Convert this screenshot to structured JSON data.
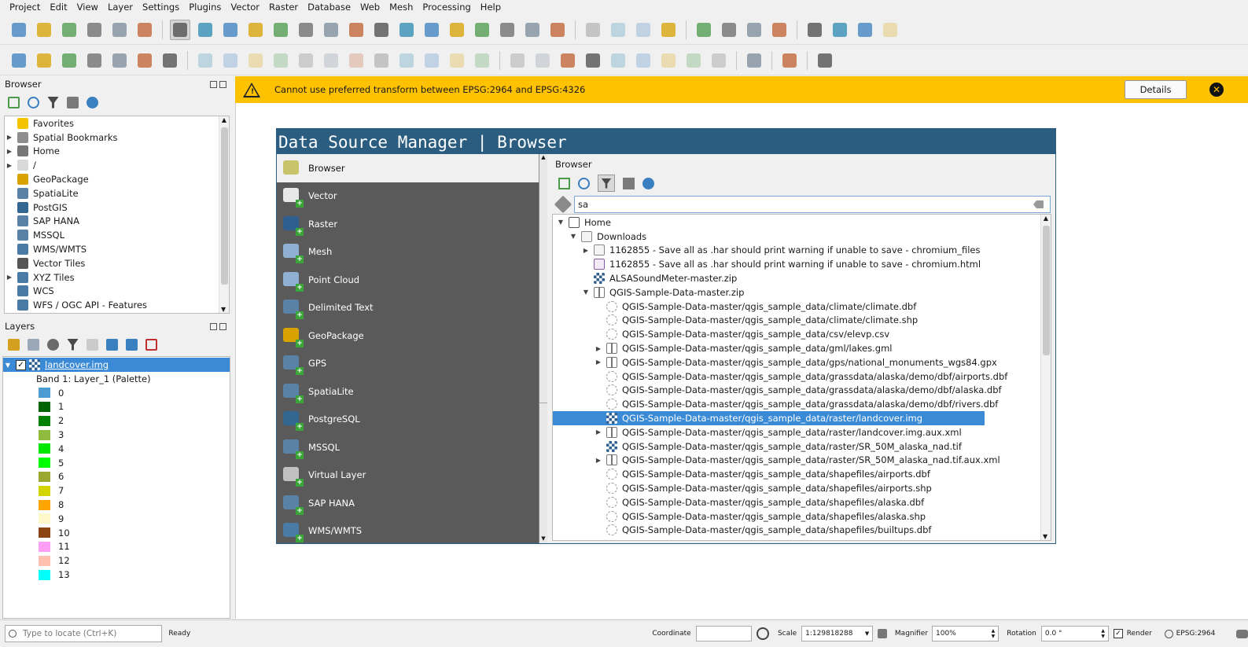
{
  "menus": [
    "Project",
    "Edit",
    "View",
    "Layer",
    "Settings",
    "Plugins",
    "Vector",
    "Raster",
    "Database",
    "Web",
    "Mesh",
    "Processing",
    "Help"
  ],
  "toolbar1_icons": [
    "new-project-icon",
    "open-project-icon",
    "save-project-icon",
    "new-print-layout-icon",
    "layout-manager-icon",
    "style-manager-icon",
    "pan-icon",
    "pan-to-selection-icon",
    "zoom-in-icon",
    "zoom-out-icon",
    "zoom-full-icon",
    "zoom-to-selection-icon",
    "zoom-to-layer-icon",
    "zoom-native-icon",
    "zoom-last-icon",
    "zoom-next-icon",
    "new-map-view-icon",
    "new-3d-map-icon",
    "new-bookmark-icon",
    "show-bookmarks-icon",
    "temporal-controller-icon",
    "refresh-icon",
    "select-features-icon",
    "attribute-table-icon",
    "deselect-icon",
    "select-by-location-icon",
    "identify-icon",
    "open-field-calculator-icon",
    "processing-toolbox-icon",
    "statistical-summary-icon",
    "attribute-table2-icon",
    "measure-icon",
    "map-tips-icon",
    "actions-icon"
  ],
  "toolbar2_icons": [
    "data-source-manager-icon",
    "new-geopackage-layer-icon",
    "new-shapefile-layer-icon",
    "new-spatialite-layer-icon",
    "new-temp-layer-icon",
    "new-virtual-layer-icon",
    "add-mesh-icon",
    "current-edits-icon",
    "toggle-editing-icon",
    "save-edits-icon",
    "digitize-icon",
    "vertex-tool-icon",
    "modify-attributes-icon",
    "delete-selected-icon",
    "cut-icon",
    "copy-icon",
    "paste-icon",
    "undo-icon",
    "redo-icon",
    "label-toolbar-icon",
    "layer-diagram-icon",
    "highlight-pinned-icon",
    "label-abc-icon",
    "pin-label-icon",
    "show-label-icon",
    "move-label-icon",
    "rotate-label-icon",
    "change-label-icon",
    "gps-icon",
    "python-console-icon",
    "help-icon"
  ],
  "browser_panel": {
    "title": "Browser",
    "items": [
      {
        "label": "Favorites",
        "icon": "star-icon",
        "expandable": false,
        "color": "#f5c400"
      },
      {
        "label": "Spatial Bookmarks",
        "icon": "bookmark-icon",
        "expandable": true,
        "color": "#8e8e8e"
      },
      {
        "label": "Home",
        "icon": "home-icon",
        "expandable": true,
        "color": "#777777"
      },
      {
        "label": "/",
        "icon": "folder-icon",
        "expandable": true,
        "color": "#d9d9d9"
      },
      {
        "label": "GeoPackage",
        "icon": "geopackage-icon",
        "expandable": false,
        "color": "#d8a200"
      },
      {
        "label": "SpatiaLite",
        "icon": "spatialite-icon",
        "expandable": false,
        "color": "#5a82a6"
      },
      {
        "label": "PostGIS",
        "icon": "postgis-icon",
        "expandable": false,
        "color": "#336791"
      },
      {
        "label": "SAP HANA",
        "icon": "sap-hana-icon",
        "expandable": false,
        "color": "#5a82a6"
      },
      {
        "label": "MSSQL",
        "icon": "mssql-icon",
        "expandable": false,
        "color": "#5a82a6"
      },
      {
        "label": "WMS/WMTS",
        "icon": "wms-icon",
        "expandable": false,
        "color": "#4a7ba6"
      },
      {
        "label": "Vector Tiles",
        "icon": "vector-tiles-icon",
        "expandable": false,
        "color": "#555555"
      },
      {
        "label": "XYZ Tiles",
        "icon": "xyz-tiles-icon",
        "expandable": true,
        "color": "#4a7ba6"
      },
      {
        "label": "WCS",
        "icon": "wcs-icon",
        "expandable": false,
        "color": "#4a7ba6"
      },
      {
        "label": "WFS / OGC API - Features",
        "icon": "wfs-icon",
        "expandable": false,
        "color": "#4a7ba6"
      }
    ]
  },
  "layers_panel": {
    "title": "Layers",
    "layer_name": "landcover.img",
    "band_label": "Band 1: Layer_1 (Palette)",
    "classes": [
      {
        "label": "0",
        "color": "#4b9cd3"
      },
      {
        "label": "1",
        "color": "#006400"
      },
      {
        "label": "2",
        "color": "#008000"
      },
      {
        "label": "3",
        "color": "#8fbc3f"
      },
      {
        "label": "4",
        "color": "#00e600"
      },
      {
        "label": "5",
        "color": "#00ff00"
      },
      {
        "label": "6",
        "color": "#9aa830"
      },
      {
        "label": "7",
        "color": "#d4d400"
      },
      {
        "label": "8",
        "color": "#ffa500"
      },
      {
        "label": "9",
        "color": "#fff8c8"
      },
      {
        "label": "10",
        "color": "#8b4513"
      },
      {
        "label": "11",
        "color": "#ff9ef5"
      },
      {
        "label": "12",
        "color": "#ffc0b0"
      },
      {
        "label": "13",
        "color": "#00ffff"
      }
    ]
  },
  "message_bar": {
    "text": "Cannot use preferred transform between EPSG:2964 and EPSG:4326",
    "details_label": "Details"
  },
  "dsm": {
    "title": "Data Source Manager | Browser",
    "categories": [
      {
        "label": "Browser",
        "icon": "folder-icon",
        "selected": true
      },
      {
        "label": "Vector",
        "icon": "add-vector-icon"
      },
      {
        "label": "Raster",
        "icon": "add-raster-icon"
      },
      {
        "label": "Mesh",
        "icon": "add-mesh-icon"
      },
      {
        "label": "Point Cloud",
        "icon": "add-point-cloud-icon"
      },
      {
        "label": "Delimited Text",
        "icon": "add-delimited-text-icon"
      },
      {
        "label": "GeoPackage",
        "icon": "add-geopackage-icon"
      },
      {
        "label": "GPS",
        "icon": "add-gps-icon"
      },
      {
        "label": "SpatiaLite",
        "icon": "add-spatialite-icon"
      },
      {
        "label": "PostgreSQL",
        "icon": "add-postgresql-icon"
      },
      {
        "label": "MSSQL",
        "icon": "add-mssql-icon"
      },
      {
        "label": "Virtual Layer",
        "icon": "add-virtual-layer-icon"
      },
      {
        "label": "SAP HANA",
        "icon": "add-sap-hana-icon"
      },
      {
        "label": "WMS/WMTS",
        "icon": "add-wms-icon"
      }
    ],
    "browser_title": "Browser",
    "filter_value": "sa",
    "tree": [
      {
        "label": "Home",
        "depth": 0,
        "arrow": "down",
        "icon": "home-icon"
      },
      {
        "label": "Downloads",
        "depth": 1,
        "arrow": "down",
        "icon": "folder-icon"
      },
      {
        "label": "1162855 - Save all as .har should print warning if unable to save - chromium_files",
        "depth": 2,
        "arrow": "right",
        "icon": "folder-icon"
      },
      {
        "label": "1162855 - Save all as .har should print warning if unable to save - chromium.html",
        "depth": 2,
        "arrow": "",
        "icon": "html-file-icon"
      },
      {
        "label": "ALSASoundMeter-master.zip",
        "depth": 2,
        "arrow": "",
        "icon": "raster-icon"
      },
      {
        "label": "QGIS-Sample-Data-master.zip",
        "depth": 2,
        "arrow": "down",
        "icon": "zip-icon"
      },
      {
        "label": "QGIS-Sample-Data-master/qgis_sample_data/climate/climate.dbf",
        "depth": 3,
        "arrow": "",
        "icon": "vector-layer-icon"
      },
      {
        "label": "QGIS-Sample-Data-master/qgis_sample_data/climate/climate.shp",
        "depth": 3,
        "arrow": "",
        "icon": "vector-layer-icon"
      },
      {
        "label": "QGIS-Sample-Data-master/qgis_sample_data/csv/elevp.csv",
        "depth": 3,
        "arrow": "",
        "icon": "vector-layer-icon"
      },
      {
        "label": "QGIS-Sample-Data-master/qgis_sample_data/gml/lakes.gml",
        "depth": 3,
        "arrow": "right",
        "icon": "zip-icon"
      },
      {
        "label": "QGIS-Sample-Data-master/qgis_sample_data/gps/national_monuments_wgs84.gpx",
        "depth": 3,
        "arrow": "right",
        "icon": "zip-icon"
      },
      {
        "label": "QGIS-Sample-Data-master/qgis_sample_data/grassdata/alaska/demo/dbf/airports.dbf",
        "depth": 3,
        "arrow": "",
        "icon": "vector-layer-icon"
      },
      {
        "label": "QGIS-Sample-Data-master/qgis_sample_data/grassdata/alaska/demo/dbf/alaska.dbf",
        "depth": 3,
        "arrow": "",
        "icon": "vector-layer-icon"
      },
      {
        "label": "QGIS-Sample-Data-master/qgis_sample_data/grassdata/alaska/demo/dbf/rivers.dbf",
        "depth": 3,
        "arrow": "",
        "icon": "vector-layer-icon"
      },
      {
        "label": "QGIS-Sample-Data-master/qgis_sample_data/raster/landcover.img",
        "depth": 3,
        "arrow": "",
        "icon": "raster-icon",
        "selected": true
      },
      {
        "label": "QGIS-Sample-Data-master/qgis_sample_data/raster/landcover.img.aux.xml",
        "depth": 3,
        "arrow": "right",
        "icon": "zip-icon"
      },
      {
        "label": "QGIS-Sample-Data-master/qgis_sample_data/raster/SR_50M_alaska_nad.tif",
        "depth": 3,
        "arrow": "",
        "icon": "raster-icon"
      },
      {
        "label": "QGIS-Sample-Data-master/qgis_sample_data/raster/SR_50M_alaska_nad.tif.aux.xml",
        "depth": 3,
        "arrow": "right",
        "icon": "zip-icon"
      },
      {
        "label": "QGIS-Sample-Data-master/qgis_sample_data/shapefiles/airports.dbf",
        "depth": 3,
        "arrow": "",
        "icon": "vector-layer-icon"
      },
      {
        "label": "QGIS-Sample-Data-master/qgis_sample_data/shapefiles/airports.shp",
        "depth": 3,
        "arrow": "",
        "icon": "vector-layer-icon"
      },
      {
        "label": "QGIS-Sample-Data-master/qgis_sample_data/shapefiles/alaska.dbf",
        "depth": 3,
        "arrow": "",
        "icon": "vector-layer-icon"
      },
      {
        "label": "QGIS-Sample-Data-master/qgis_sample_data/shapefiles/alaska.shp",
        "depth": 3,
        "arrow": "",
        "icon": "vector-layer-icon"
      },
      {
        "label": "QGIS-Sample-Data-master/qgis_sample_data/shapefiles/builtups.dbf",
        "depth": 3,
        "arrow": "",
        "icon": "vector-layer-icon"
      }
    ]
  },
  "status": {
    "locate_placeholder": "Type to locate (Ctrl+K)",
    "ready": "Ready",
    "coordinate_label": "Coordinate",
    "coordinate_value": "",
    "scale_label": "Scale",
    "scale_value": "1:129818288",
    "magnifier_label": "Magnifier",
    "magnifier_value": "100%",
    "rotation_label": "Rotation",
    "rotation_value": "0.0 °",
    "render_label": "Render",
    "crs": "EPSG:2964"
  },
  "colors": {
    "accent": "#3a8ad6",
    "message_bar": "#ffc200",
    "dsm_title_bg": "#2a5d80",
    "dsm_left_bg": "#5a5a5a"
  }
}
